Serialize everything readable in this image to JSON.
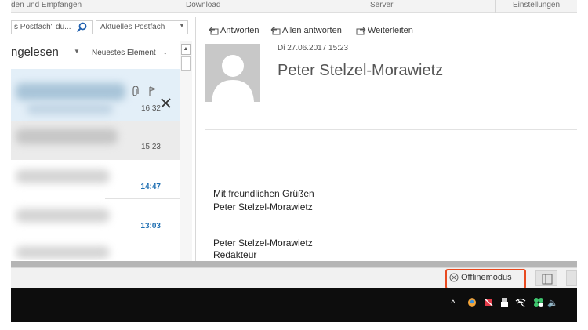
{
  "ribbon": {
    "tabs": [
      "den und Empfangen",
      "Download",
      "Server",
      "Einstellungen"
    ]
  },
  "list_header": {
    "search_placeholder": "s Postfach\" du...",
    "scope": "Aktuelles Postfach",
    "filter": "ngelesen",
    "sort": "Neuestes Element"
  },
  "messages": [
    {
      "time": "16:32"
    },
    {
      "time": "15:23"
    },
    {
      "time": "14:47"
    },
    {
      "time": "13:03"
    }
  ],
  "reading": {
    "actions": [
      "Antworten",
      "Allen antworten",
      "Weiterleiten"
    ],
    "date": "Di 27.06.2017 15:23",
    "sender": "Peter Stelzel-Morawietz",
    "body": [
      "Mit freundlichen Grüßen",
      "Peter Stelzel-Morawietz",
      "Peter Stelzel-Morawietz",
      "Redakteur"
    ]
  },
  "status": {
    "offline_label": "Offlinemodus"
  },
  "colors": {
    "selected_row": "#e3eff8",
    "unread_time": "#1f6fb2",
    "highlight_border": "#e84a20",
    "taskbar": "#0d0d0d"
  },
  "icons": [
    "search-icon",
    "reply-icon",
    "reply-all-icon",
    "forward-icon",
    "attachment-icon",
    "flag-icon",
    "delete-icon",
    "avatar-icon",
    "offline-icon",
    "chevron-up-icon",
    "defender-icon",
    "flag-tray-icon",
    "usb-icon",
    "network-icon",
    "security-icon",
    "volume-icon"
  ]
}
